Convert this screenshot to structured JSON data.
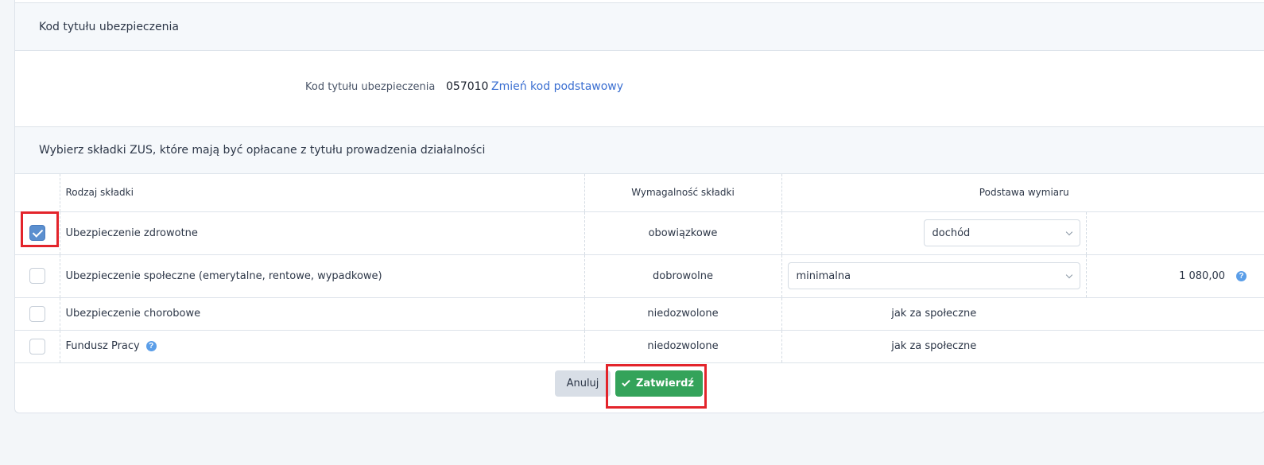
{
  "section1": {
    "header": "Kod tytułu ubezpieczenia",
    "code_label": "Kod tytułu ubezpieczenia",
    "code_value": "057010",
    "change_link": "Zmień kod podstawowy"
  },
  "section2": {
    "header": "Wybierz składki ZUS, które mają być opłacane z tytułu prowadzenia działalności"
  },
  "table": {
    "headers": [
      "Rodzaj składki",
      "Wymagalność składki",
      "Podstawa wymiaru"
    ],
    "rows": [
      {
        "checked": true,
        "name": "Ubezpieczenie zdrowotne",
        "requirement": "obowiązkowe",
        "basis_select": "dochód",
        "amount": ""
      },
      {
        "checked": false,
        "name": "Ubezpieczenie społeczne (emerytalne, rentowe, wypadkowe)",
        "requirement": "dobrowolne",
        "basis_select": "minimalna",
        "amount": "1 080,00"
      },
      {
        "checked": false,
        "name": "Ubezpieczenie chorobowe",
        "requirement": "niedozwolone",
        "basis_text": "jak za społeczne"
      },
      {
        "checked": false,
        "name": "Fundusz Pracy",
        "requirement": "niedozwolone",
        "basis_text": "jak za społeczne"
      }
    ]
  },
  "buttons": {
    "cancel": "Anuluj",
    "confirm": "Zatwierdź"
  },
  "icons": {
    "help": "?",
    "help_color": "#5b9ee8"
  },
  "colors": {
    "confirm_bg": "#34a35a",
    "link": "#3b6fd1",
    "highlight": "#e3242b",
    "checkbox_checked": "#5b8fcf"
  }
}
